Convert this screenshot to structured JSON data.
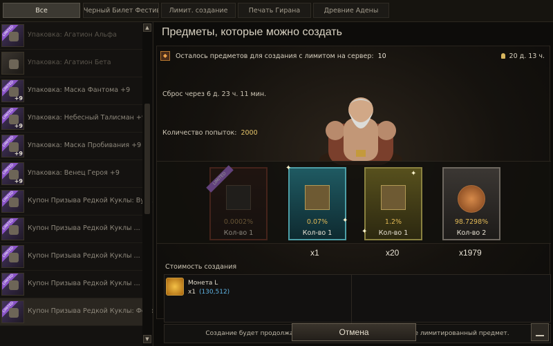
{
  "tabs": [
    "Все",
    "Черный Билет Фестиваля",
    "Лимит. создание",
    "Печать Гирана",
    "Древние Адены"
  ],
  "list": {
    "items": [
      {
        "label": "Упаковка: Агатион Альфа",
        "limited": true,
        "plus": "",
        "dim": true
      },
      {
        "label": "Упаковка: Агатион Бета",
        "limited": false,
        "plus": "",
        "dim": true
      },
      {
        "label": "Упаковка: Маска Фантома +9",
        "limited": true,
        "plus": "+9",
        "dim": false
      },
      {
        "label": "Упаковка: Небесный Талисман +9",
        "limited": true,
        "plus": "+9",
        "dim": false
      },
      {
        "label": "Упаковка: Маска Пробивания +9",
        "limited": true,
        "plus": "+9",
        "dim": false
      },
      {
        "label": "Упаковка: Венец Героя +9",
        "limited": true,
        "plus": "+9",
        "dim": false
      },
      {
        "label": "Купон Призыва Редкой Куклы: Вулкан",
        "limited": true,
        "plus": "",
        "dim": false
      },
      {
        "label": "Купон Призыва Редкой Куклы ...",
        "limited": true,
        "plus": "",
        "dim": false
      },
      {
        "label": "Купон Призыва Редкой Куклы ...",
        "limited": true,
        "plus": "",
        "dim": false
      },
      {
        "label": "Купон Призыва Редкой Куклы ...",
        "limited": true,
        "plus": "",
        "dim": false
      },
      {
        "label": "Купон Призыва Редкой Куклы: Фекон",
        "limited": true,
        "plus": "",
        "dim": false
      }
    ],
    "scroll_up": "▲",
    "scroll_down": "▼",
    "ribbon_text": "LIMITED"
  },
  "main": {
    "title": "Предметы, которые можно создать",
    "limit_text": "Осталось предметов для создания с лимитом на сервер:",
    "limit_value": "10",
    "timer": "20 д. 13 ч.",
    "reset": "Сброс через 6 д. 23 ч. 11 мин.",
    "attempts_label": "Количество попыток:",
    "attempts_value": "2000"
  },
  "rewards": [
    {
      "pct": "0.0002%",
      "qty": "Кол-во 1",
      "limited": true,
      "mult": ""
    },
    {
      "pct": "0.07%",
      "qty": "Кол-во 1",
      "limited": false,
      "mult": "x1"
    },
    {
      "pct": "1.2%",
      "qty": "Кол-во 1",
      "limited": false,
      "mult": "x20"
    },
    {
      "pct": "98.7298%",
      "qty": "Кол-во 2",
      "limited": false,
      "mult": "x1979"
    }
  ],
  "cost": {
    "label": "Стоимость создания",
    "coin_name": "Монета L",
    "coin_qty": "x1",
    "coin_owned": "(130,512)"
  },
  "note": "Создание будет продолжаться до тех пор, пока Вы не получите лимитированный предмет.",
  "buttons": {
    "cancel": "Отмена"
  },
  "colors": {
    "accent_gold": "#e2b956",
    "owned_blue": "#5fb4e4",
    "limited_purple": "#a46ad7"
  }
}
